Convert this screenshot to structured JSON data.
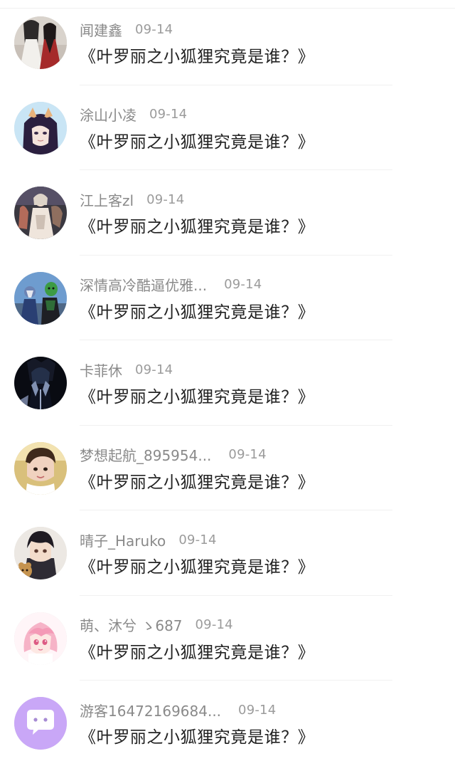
{
  "comments": [
    {
      "name": "闻建鑫",
      "date": "09-14",
      "text": "《叶罗丽之小狐狸究竟是谁？》",
      "avatar": "avatar-two-figures"
    },
    {
      "name": "涂山小凌",
      "date": "09-14",
      "text": "《叶罗丽之小狐狸究竟是谁？》",
      "avatar": "avatar-fox-girl"
    },
    {
      "name": "江上客zl",
      "date": "09-14",
      "text": "《叶罗丽之小狐狸究竟是谁？》",
      "avatar": "avatar-robed-figure"
    },
    {
      "name": "深情高冷酷逼优雅...",
      "date": "09-14",
      "text": "《叶罗丽之小狐狸究竟是谁？》",
      "avatar": "avatar-heroes"
    },
    {
      "name": "卡菲休",
      "date": "09-14",
      "text": "《叶罗丽之小狐狸究竟是谁？》",
      "avatar": "avatar-dark-character"
    },
    {
      "name": "梦想起航_895954...",
      "date": "09-14",
      "text": "《叶罗丽之小狐狸究竟是谁？》",
      "avatar": "avatar-boy"
    },
    {
      "name": "晴子_Haruko",
      "date": "09-14",
      "text": "《叶罗丽之小狐狸究竟是谁？》",
      "avatar": "avatar-anime-boy"
    },
    {
      "name": "萌、沐兮 ゝ687",
      "date": "09-14",
      "text": "《叶罗丽之小狐狸究竟是谁？》",
      "avatar": "avatar-pink-girl"
    },
    {
      "name": "游客16472169684...",
      "date": "09-14",
      "text": "《叶罗丽之小狐狸究竟是谁？》",
      "avatar": "avatar-default-chat"
    }
  ],
  "colors": {
    "name": "#8a8a8a",
    "date": "#9b9b9b",
    "text": "#222222",
    "divider": "#f1f1f1",
    "default_avatar": "#c9a7f7"
  }
}
